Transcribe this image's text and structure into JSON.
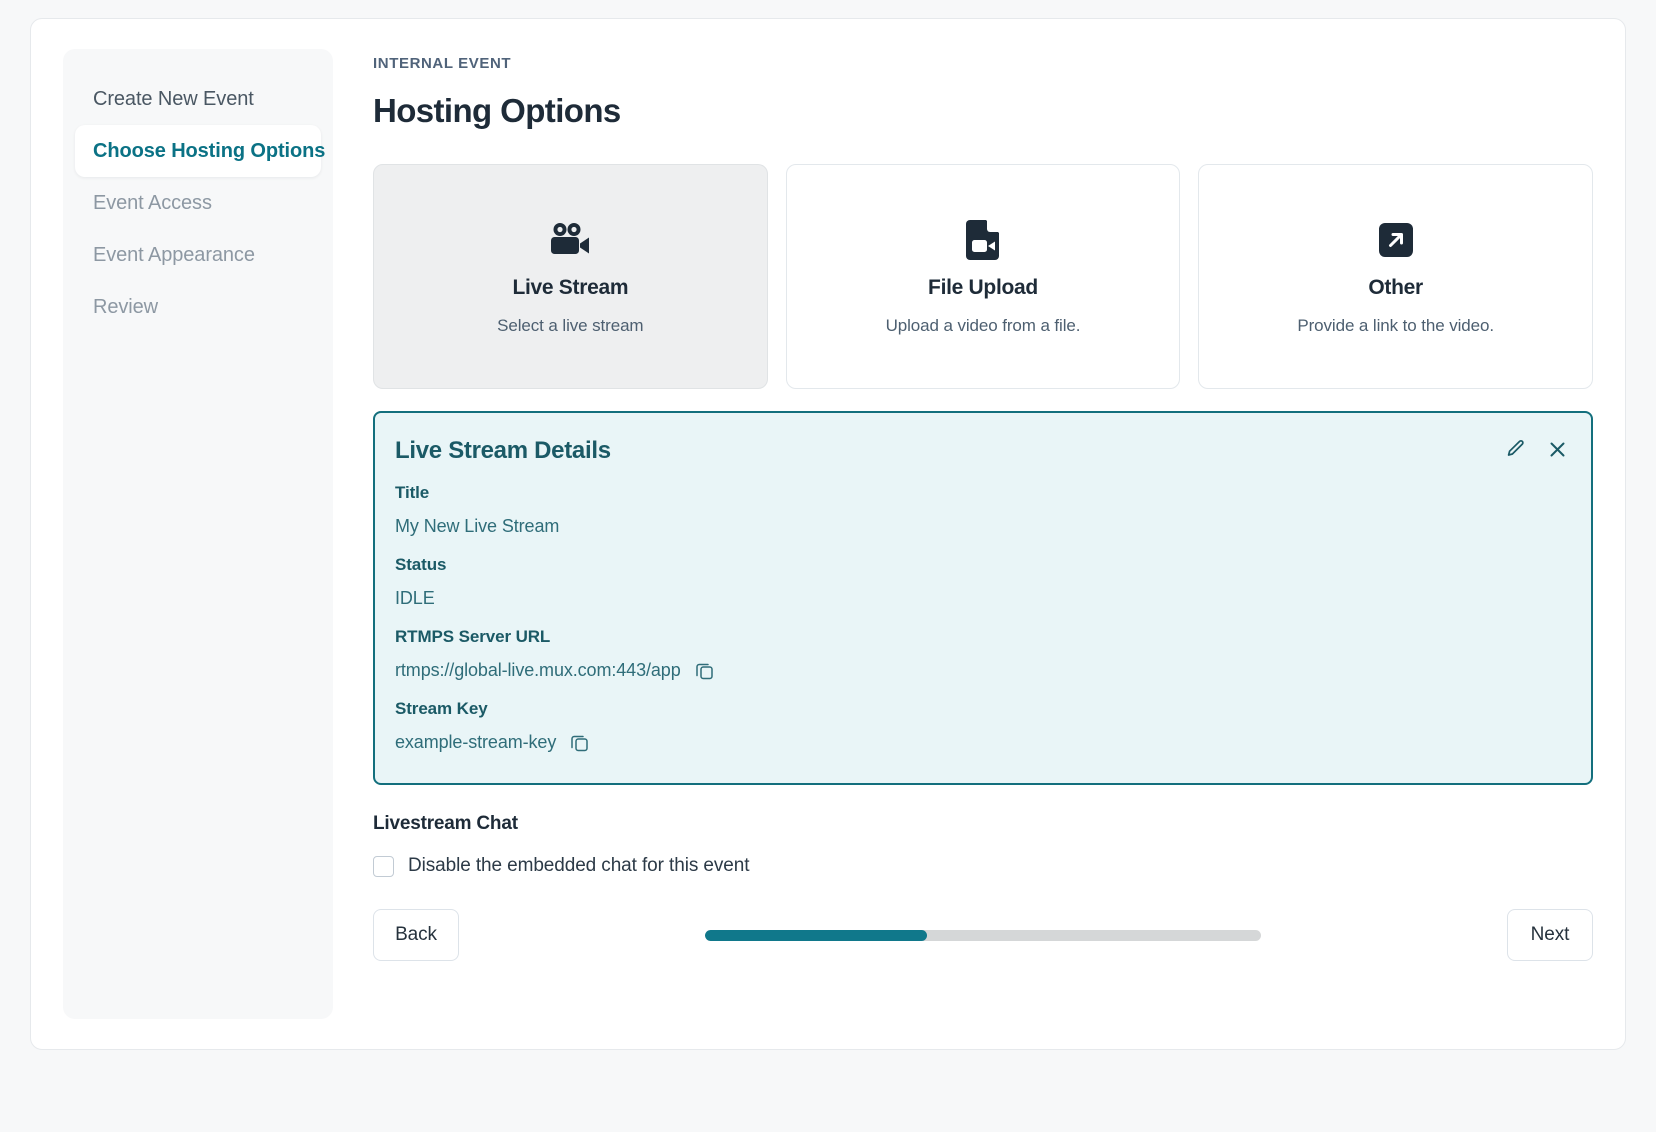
{
  "sidebar": {
    "items": [
      {
        "label": "Create New Event",
        "state": "visited"
      },
      {
        "label": "Choose Hosting Options",
        "state": "active"
      },
      {
        "label": "Event Access",
        "state": "upcoming"
      },
      {
        "label": "Event Appearance",
        "state": "upcoming"
      },
      {
        "label": "Review",
        "state": "upcoming"
      }
    ]
  },
  "header": {
    "eyebrow": "INTERNAL EVENT",
    "title": "Hosting Options"
  },
  "options": [
    {
      "icon": "video-camera-icon",
      "title": "Live Stream",
      "description": "Select a live stream",
      "selected": true
    },
    {
      "icon": "file-video-icon",
      "title": "File Upload",
      "description": "Upload a video from a file.",
      "selected": false
    },
    {
      "icon": "external-link-icon",
      "title": "Other",
      "description": "Provide a link to the video.",
      "selected": false
    }
  ],
  "details": {
    "heading": "Live Stream Details",
    "edit_icon": "pencil-icon",
    "close_icon": "close-icon",
    "fields": [
      {
        "label": "Title",
        "value": "My New Live Stream",
        "copyable": false
      },
      {
        "label": "Status",
        "value": "IDLE",
        "copyable": false
      },
      {
        "label": "RTMPS Server URL",
        "value": "rtmps://global-live.mux.com:443/app",
        "copyable": true
      },
      {
        "label": "Stream Key",
        "value": "example-stream-key",
        "copyable": true
      }
    ],
    "accent_border": "#136f7d",
    "background": "#e9f5f7"
  },
  "chat": {
    "title": "Livestream Chat",
    "checkbox_label": "Disable the embedded chat for this event",
    "checked": false
  },
  "footer": {
    "back_label": "Back",
    "next_label": "Next",
    "progress_percent": 40,
    "progress_color": "#10788b"
  }
}
